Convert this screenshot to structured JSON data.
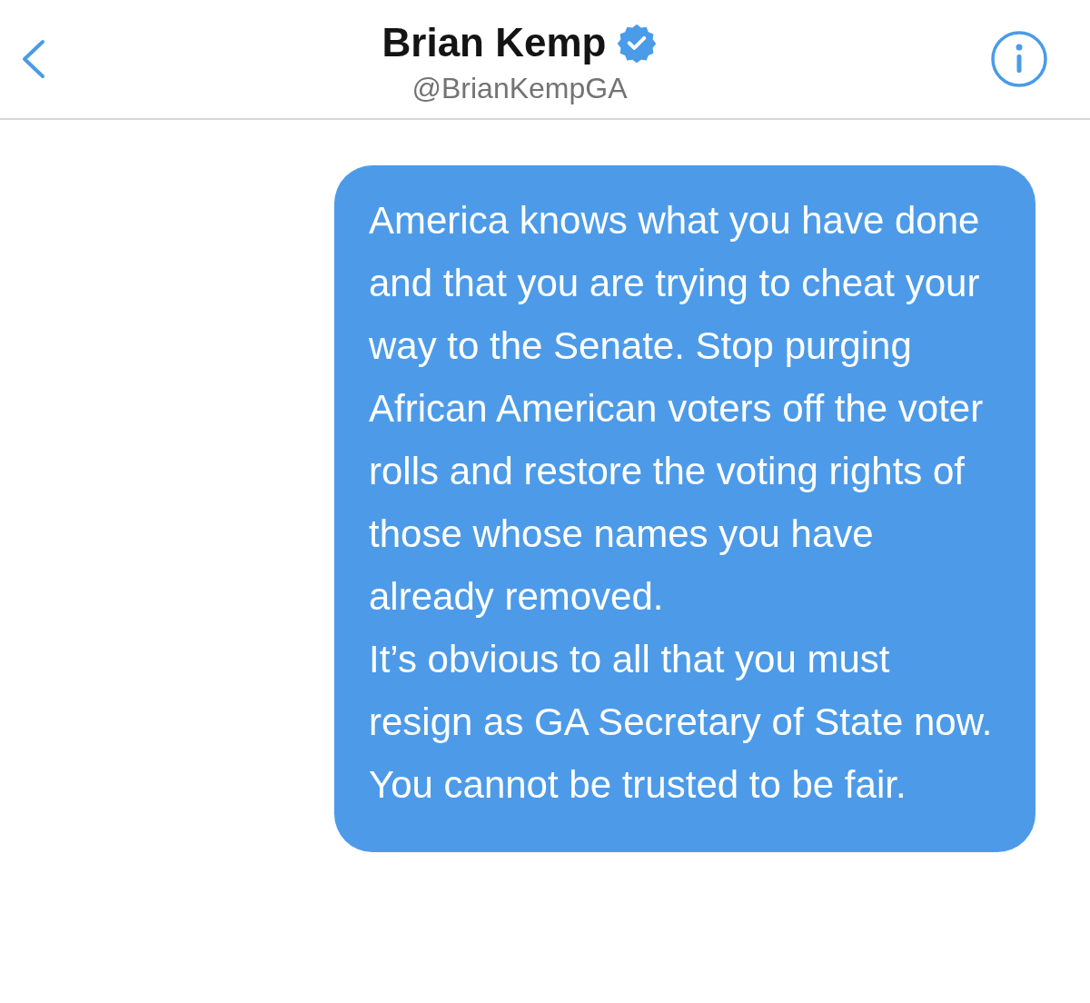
{
  "header": {
    "name": "Brian Kemp",
    "verified": true,
    "handle": "@BrianKempGA"
  },
  "messages": [
    {
      "paragraphs": [
        "America knows what you have done and that you are trying to cheat your way to the Senate. Stop purging African American voters off the voter rolls and restore the voting rights of those whose names you have already removed.",
        "It’s obvious to all that you must resign as GA Secretary of State now. You cannot be trusted to be fair."
      ]
    }
  ]
}
